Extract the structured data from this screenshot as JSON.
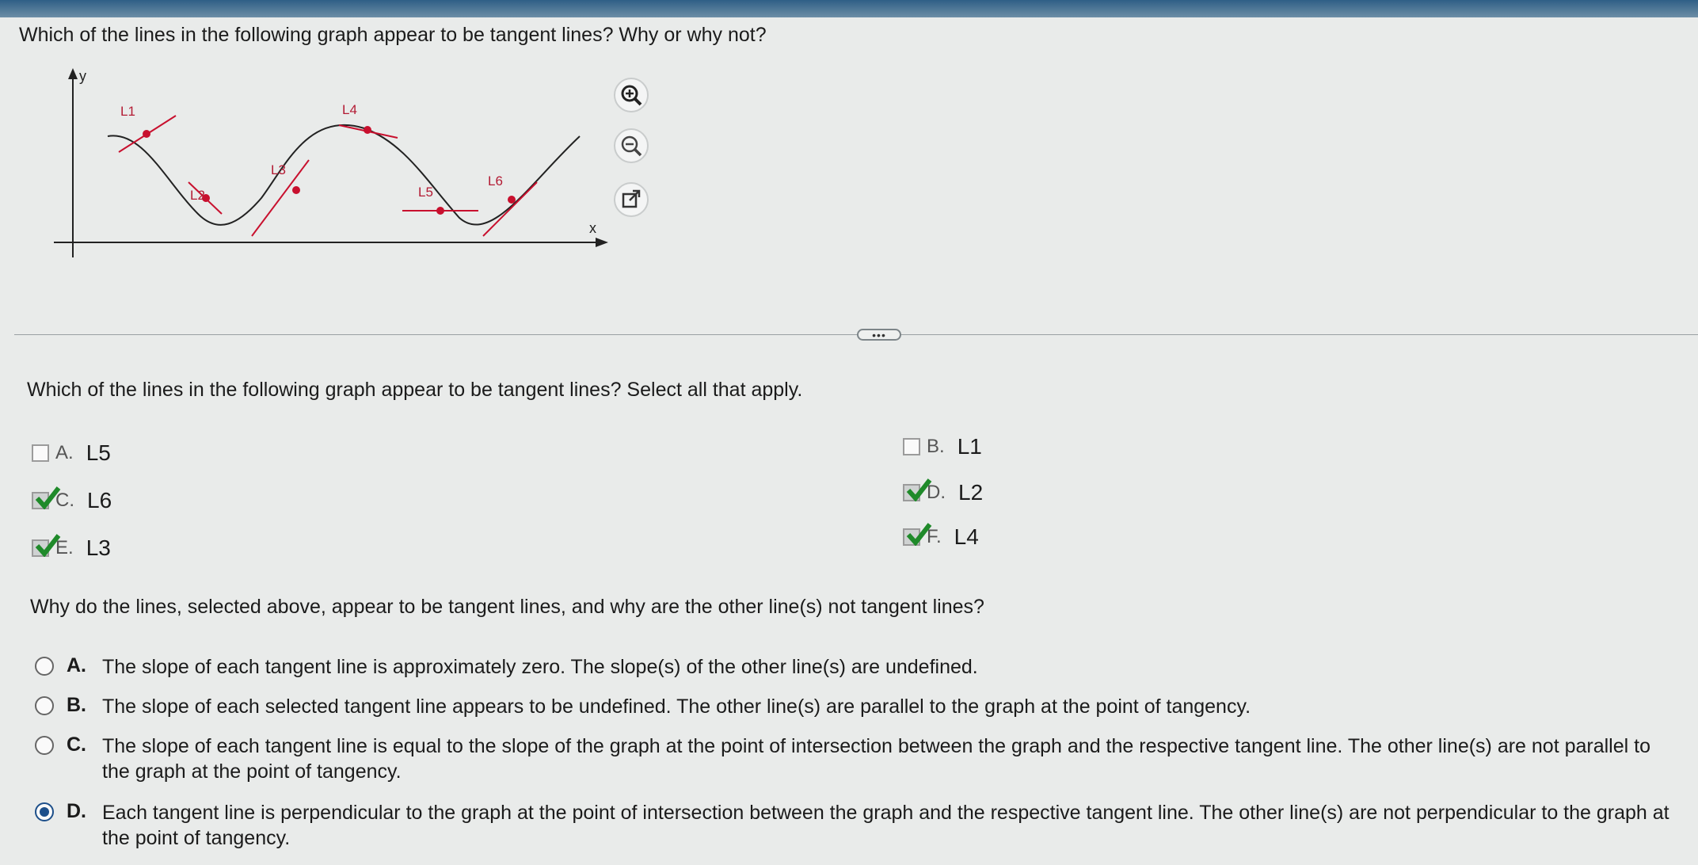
{
  "question": "Which of the lines in the following graph appear to be tangent lines? Why or why not?",
  "graph": {
    "y_label": "y",
    "x_label": "x",
    "line_labels": [
      "L1",
      "L2",
      "L3",
      "L4",
      "L5",
      "L6"
    ]
  },
  "tools": {
    "zoom_in": "zoom-in-icon",
    "zoom_out": "zoom-out-icon",
    "popout": "external-link-icon"
  },
  "more_label": "•••",
  "part1": {
    "prompt": "Which of the lines in the following graph appear to be tangent lines? Select all that apply.",
    "options": [
      {
        "letter": "A.",
        "value": "L5",
        "checked": false
      },
      {
        "letter": "B.",
        "value": "L1",
        "checked": false
      },
      {
        "letter": "C.",
        "value": "L6",
        "checked": true
      },
      {
        "letter": "D.",
        "value": "L2",
        "checked": true
      },
      {
        "letter": "E.",
        "value": "L3",
        "checked": true
      },
      {
        "letter": "F.",
        "value": "L4",
        "checked": true
      }
    ]
  },
  "part2": {
    "prompt": "Why do the lines, selected above, appear to be tangent lines, and why are the other line(s) not tangent lines?",
    "answers": [
      {
        "letter": "A.",
        "text": "The slope of each tangent line is approximately zero. The slope(s) of the other line(s) are undefined.",
        "selected": false
      },
      {
        "letter": "B.",
        "text": "The slope of each selected tangent line appears to be undefined. The other line(s) are parallel to the graph at the point of tangency.",
        "selected": false
      },
      {
        "letter": "C.",
        "text": "The slope of each tangent line is equal to the slope of the graph at the point of intersection between the graph and the respective tangent line. The other line(s) are not parallel to the graph at the point of tangency.",
        "selected": false
      },
      {
        "letter": "D.",
        "text": "Each tangent line is perpendicular to the graph at the point of intersection between the graph and the respective tangent line. The other line(s) are not perpendicular to the graph at the point of tangency.",
        "selected": true
      }
    ]
  },
  "colors": {
    "tangent_red": "#c8102e",
    "check_green": "#1f8a2a",
    "radio_blue": "#1d4f8a"
  }
}
